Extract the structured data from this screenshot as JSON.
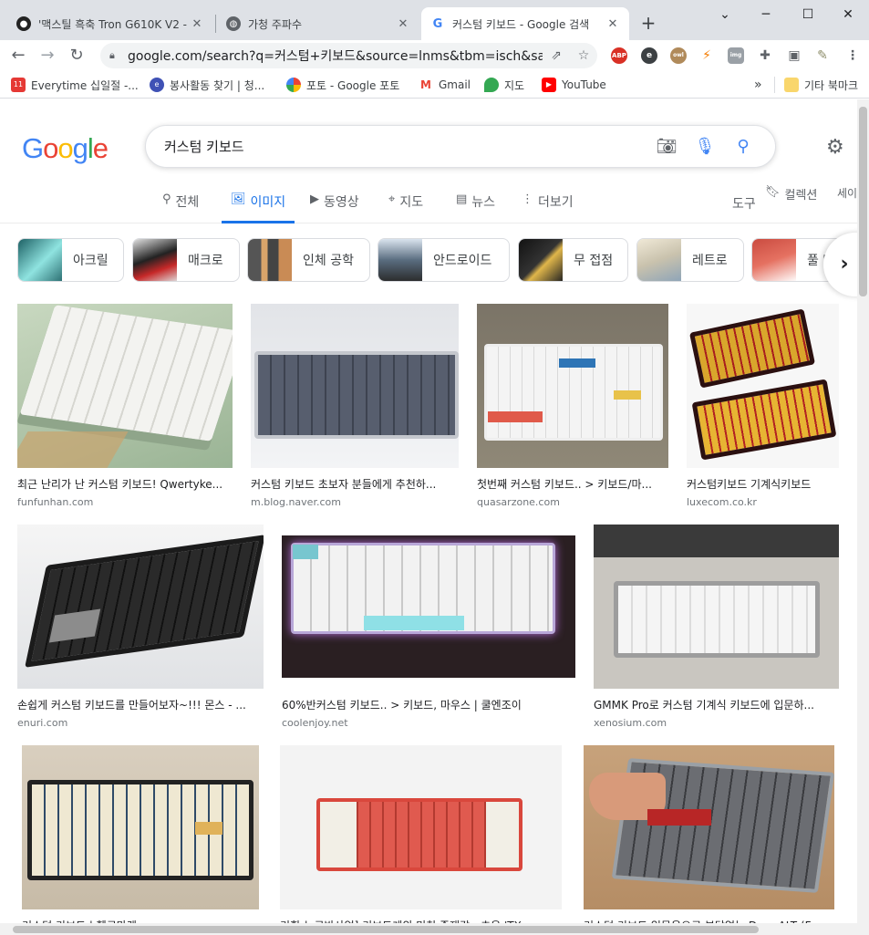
{
  "browser": {
    "tabs": [
      {
        "title": "'맥스틸 흑축 Tron G610K V2 -",
        "favicon": "maxtill-icon"
      },
      {
        "title": "가청 주파수",
        "favicon": "globe-icon"
      },
      {
        "title": "커스텀 키보드 - Google 검색",
        "favicon": "google-icon"
      }
    ],
    "new_tab": "+",
    "window_controls": {
      "minimize": "─",
      "maximize": "☐",
      "close": "✕",
      "tab_search": "⌄"
    },
    "url": "google.com/search?q=커스텀+키보드&source=lnms&tbm=isch&sa...",
    "extensions": [
      "ABP",
      "e",
      "owl",
      "⚡",
      "img",
      "puzzle",
      "panel",
      "pencil",
      "menu"
    ],
    "bookmarks": [
      "Everytime 십일절 -...",
      "봉사활동 찾기 | 청...",
      "포토 - Google 포토",
      "Gmail",
      "지도",
      "YouTube"
    ],
    "bookmarks_overflow": "»",
    "other_bookmarks": "기타 북마크"
  },
  "search": {
    "logo": [
      "G",
      "o",
      "o",
      "g",
      "l",
      "e"
    ],
    "query": "커스텀 키보드"
  },
  "nav": {
    "tabs": [
      {
        "label": "전체",
        "icon": "search-icon"
      },
      {
        "label": "이미지",
        "icon": "image-icon"
      },
      {
        "label": "동영상",
        "icon": "video-icon"
      },
      {
        "label": "지도",
        "icon": "pin-icon"
      },
      {
        "label": "뉴스",
        "icon": "news-icon"
      },
      {
        "label": "더보기",
        "icon": "more-icon"
      }
    ],
    "tools": "도구",
    "collections": "컬렉션",
    "safe": "세이"
  },
  "chips": [
    "아크릴",
    "매크로",
    "인체 공학",
    "안드로이드",
    "무 접점",
    "레트로",
    "풀 배"
  ],
  "results": [
    {
      "caption": "최근 난리가 난 커스텀 키보드! Qwertyke...",
      "source": "funfunhan.com"
    },
    {
      "caption": "커스텀 키보드 초보자 분들에게 추천하...",
      "source": "m.blog.naver.com"
    },
    {
      "caption": "첫번째 커스텀 키보드.. > 키보드/마...",
      "source": "quasarzone.com"
    },
    {
      "caption": "커스텀키보드 기계식키보드",
      "source": "luxecom.co.kr"
    },
    {
      "caption": "손쉽게 커스텀 키보드를 만들어보자~!!! 몬스 - ...",
      "source": "enuri.com"
    },
    {
      "caption": "60%반커스텀 키보드.. > 키보드, 마우스 | 쿨엔조이",
      "source": "coolenjoy.net"
    },
    {
      "caption": "GMMK Pro로 커스텀 기계식 키보드에 입문하...",
      "source": "xenosium.com"
    },
    {
      "caption": "커스텀 키보드 | 헬로마켓",
      "source": ""
    },
    {
      "caption": "기획-뉴로반사업] 키보드계의 미친 존재감 - 초음 'TX...",
      "source": ""
    },
    {
      "caption": "커스텀 키보드 입문용으로 부담없는 Drop ALT (Fe...",
      "source": ""
    }
  ]
}
